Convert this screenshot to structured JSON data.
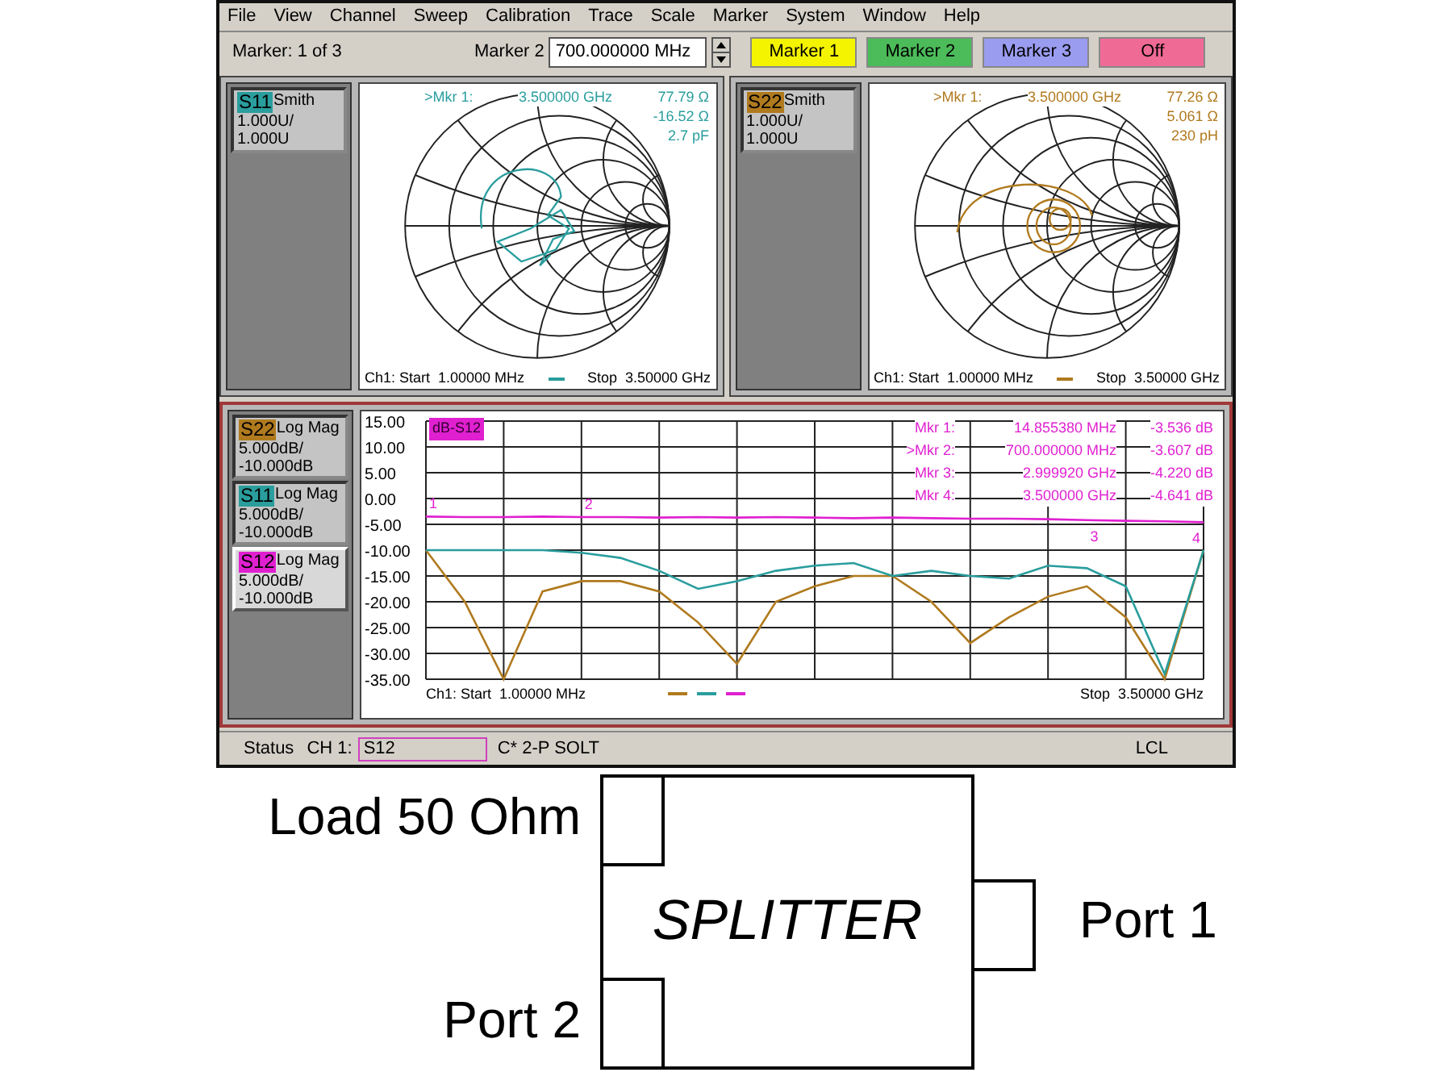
{
  "menu_bar": {
    "items": [
      "File",
      "View",
      "Channel",
      "Sweep",
      "Calibration",
      "Trace",
      "Scale",
      "Marker",
      "System",
      "Window",
      "Help"
    ]
  },
  "toolbar": {
    "marker_count": "Marker: 1 of 3",
    "marker_field_label": "Marker 2",
    "marker_value": "700.000000 MHz",
    "marker_buttons": [
      {
        "label": "Marker 1",
        "color": "#f4f400"
      },
      {
        "label": "Marker 2",
        "color": "#4cbb5a"
      },
      {
        "label": "Marker 3",
        "color": "#9a9cf0"
      },
      {
        "label": "Off",
        "color": "#f06a96"
      }
    ]
  },
  "smith_panes": [
    {
      "trace": {
        "name": "S11",
        "format": "Smith",
        "scale": "1.000U/",
        "reference": "1.000U",
        "color": "#2a9d9d"
      },
      "readout": {
        "marker": ">Mkr 1:",
        "frequency": "3.500000 GHz",
        "lines": [
          "77.79 Ω",
          "-16.52 Ω",
          "2.7 pF"
        ]
      },
      "footer": {
        "start": "Ch1: Start  1.00000 MHz",
        "stop": "Stop  3.50000 GHz"
      }
    },
    {
      "trace": {
        "name": "S22",
        "format": "Smith",
        "scale": "1.000U/",
        "reference": "1.000U",
        "color": "#b07a1e"
      },
      "readout": {
        "marker": ">Mkr 1:",
        "frequency": "3.500000 GHz",
        "lines": [
          "77.26 Ω",
          "5.061 Ω",
          "230 pH"
        ]
      },
      "footer": {
        "start": "Ch1: Start  1.00000 MHz",
        "stop": "Stop  3.50000 GHz"
      }
    }
  ],
  "log_mag_pane": {
    "traces": [
      {
        "format": "Log Mag",
        "scale": "5.000dB/",
        "reference": "-10.000dB",
        "selected": false
      },
      {
        "format": "Log Mag",
        "scale": "5.000dB/",
        "reference": "-10.000dB",
        "selected": false
      },
      {
        "format": "Log Mag",
        "scale": "5.000dB/",
        "reference": "-10.000dB",
        "selected": true
      }
    ],
    "marker_numbers": [
      "1",
      "2",
      "3",
      "4"
    ],
    "trace_tag": "dB-S12",
    "marker_table": [
      {
        "marker": "Mkr 1:",
        "stimulus": "14.855380 MHz",
        "value": "-3.536 dB"
      },
      {
        "marker": ">Mkr 2:",
        "stimulus": "700.000000 MHz",
        "value": "-3.607 dB"
      },
      {
        "marker": "Mkr 3:",
        "stimulus": "2.999920 GHz",
        "value": "-4.220 dB"
      },
      {
        "marker": "Mkr 4:",
        "stimulus": "3.500000 GHz",
        "value": "-4.641 dB"
      }
    ],
    "footer": {
      "start": "Ch1: Start  1.00000 MHz",
      "stop": "Stop  3.50000 GHz"
    },
    "chart_data": {
      "type": "line",
      "ylim": [
        -35,
        15
      ],
      "grid": true,
      "yticks": [
        {
          "value": 15,
          "label": "15.00"
        },
        {
          "value": 10,
          "label": "10.00"
        },
        {
          "value": 5,
          "label": "5.00"
        },
        {
          "value": 0,
          "label": "0.00"
        },
        {
          "value": -5,
          "label": "-5.00"
        },
        {
          "value": -10,
          "label": "-10.00"
        },
        {
          "value": -15,
          "label": "-15.00"
        },
        {
          "value": -20,
          "label": "-20.00"
        },
        {
          "value": -25,
          "label": "-25.00"
        },
        {
          "value": -30,
          "label": "-30.00"
        },
        {
          "value": -35,
          "label": "-35.00"
        }
      ],
      "categories": [
        null,
        null,
        null,
        null,
        null,
        null,
        null,
        null,
        null,
        null,
        null,
        null,
        null,
        null,
        null,
        null,
        null,
        null,
        null,
        null,
        null
      ],
      "series": [
        {
          "name": "S22",
          "color": "#b07a1e",
          "values": [
            -10,
            -20,
            -35,
            -18,
            -16,
            -16,
            -18,
            -24,
            -32,
            -20,
            -17,
            -15,
            -15,
            -20,
            -28,
            -23,
            -19,
            -17,
            -23,
            -35,
            -10
          ]
        },
        {
          "name": "S11",
          "color": "#2a9d9d",
          "values": [
            -10,
            -10,
            -10,
            -10,
            -10.5,
            -11.5,
            -14,
            -17.5,
            -16,
            -14,
            -13,
            -12.5,
            -15,
            -14,
            -15,
            -15.5,
            -13,
            -13.5,
            -17,
            -34,
            -10
          ]
        },
        {
          "name": "S12",
          "color": "#e020d0",
          "values": [
            -3.5,
            -3.6,
            -3.6,
            -3.5,
            -3.6,
            -3.6,
            -3.7,
            -3.6,
            -3.7,
            -3.6,
            -3.7,
            -3.8,
            -3.7,
            -3.8,
            -3.9,
            -3.9,
            -4,
            -4.2,
            -4.3,
            -4.4,
            -4.6
          ]
        }
      ]
    }
  },
  "status_bar": {
    "label": "Status",
    "channel": "CH 1:",
    "active_trace": "S12",
    "calibration": "C* 2-P SOLT",
    "mode": "LCL"
  },
  "diagram": {
    "block_label": "SPLITTER",
    "ports": [
      {
        "label": "Load 50 Ohm"
      },
      {
        "label": "Port 1"
      },
      {
        "label": "Port 2"
      }
    ]
  }
}
